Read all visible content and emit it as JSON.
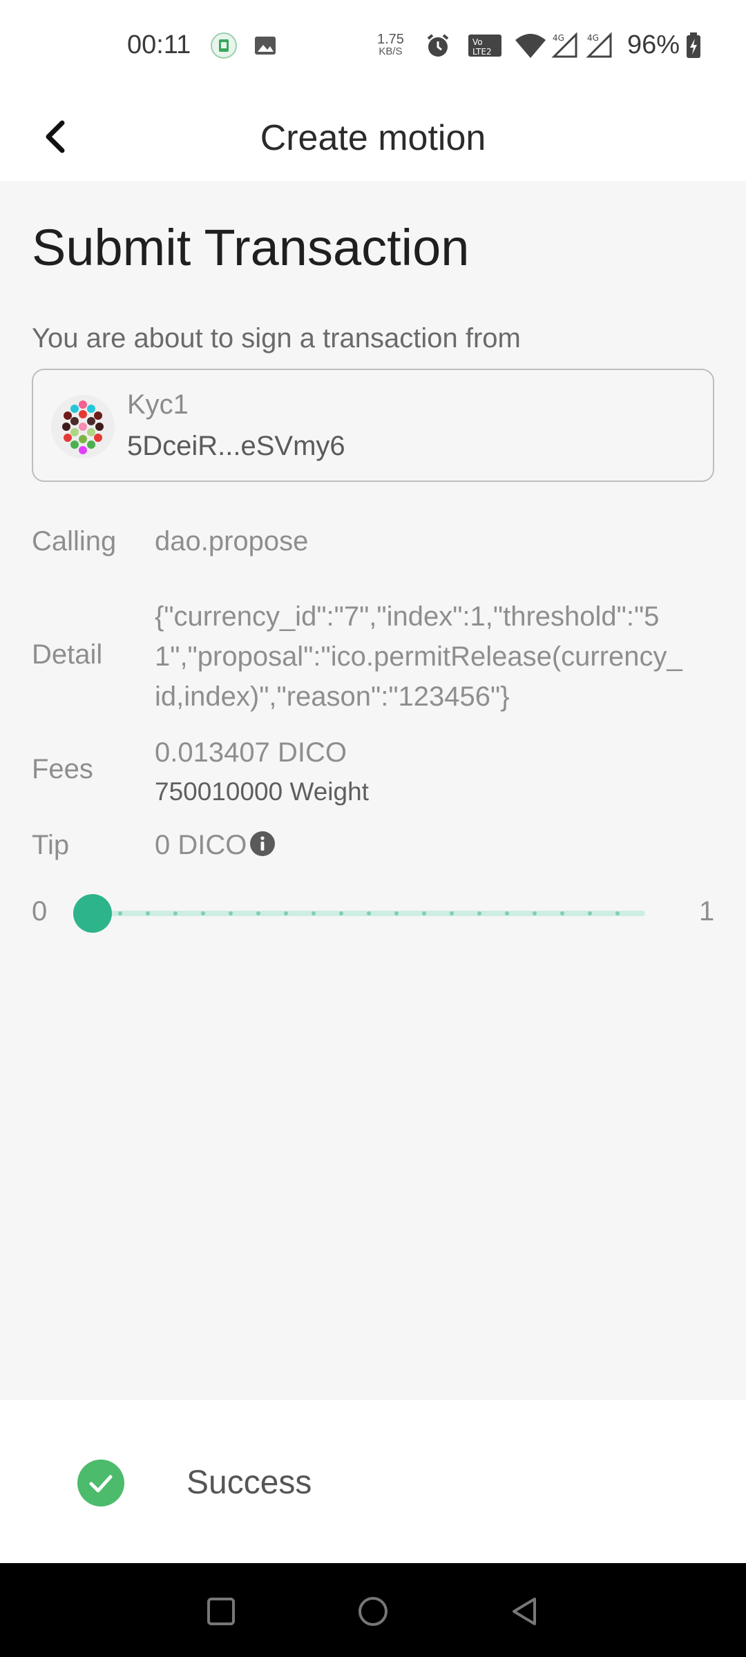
{
  "status_bar": {
    "time": "00:11",
    "net_speed_value": "1.75",
    "net_speed_unit": "KB/S",
    "battery_percent": "96%",
    "icons": [
      "sim-app-icon",
      "image-icon",
      "alarm-icon",
      "volte-icon",
      "wifi-icon",
      "signal-4g-icon",
      "signal-4g-icon",
      "battery-charging-icon"
    ]
  },
  "app_bar": {
    "title": "Create motion",
    "back_icon": "chevron-left-icon"
  },
  "transaction": {
    "heading": "Submit Transaction",
    "intro": "You are about to sign a transaction from",
    "account": {
      "name": "Kyc1",
      "address": "5DceiR...eSVmy6"
    },
    "calling_label": "Calling",
    "calling_value": "dao.propose",
    "detail_label": "Detail",
    "detail_value": "{\"currency_id\":\"7\",\"index\":1,\"threshold\":\"51\",\"proposal\":\"ico.permitRelease(currency_id,index)\",\"reason\":\"123456\"}",
    "fees_label": "Fees",
    "fees_amount": "0.013407 DICO",
    "fees_weight": "750010000 Weight",
    "tip_label": "Tip",
    "tip_value": "0 DICO",
    "tip_slider": {
      "min_label": "0",
      "max_label": "1",
      "value": 0,
      "min": 0,
      "max": 1,
      "steps": 20
    }
  },
  "toast": {
    "text": "Success",
    "icon": "check-circle-icon"
  },
  "colors": {
    "accent": "#2db48a",
    "success": "#4cbb6c",
    "background": "#f6f6f6"
  }
}
